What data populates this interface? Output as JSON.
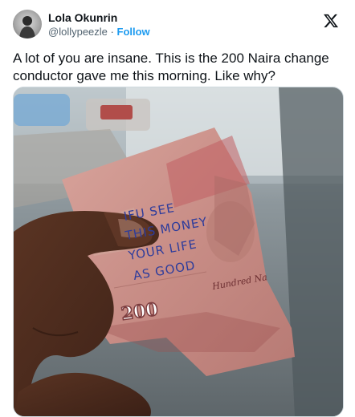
{
  "author": {
    "display_name": "Lola Okunrin",
    "handle": "@lollypeezle",
    "separator": "·",
    "follow_label": "Follow"
  },
  "tweet": {
    "text": "A lot of you are insane. This is the 200 Naira change conductor gave me this morning. Like why?"
  },
  "photo": {
    "handwriting": [
      "IFU SEE",
      "THIS MONEY",
      "YOUR LIFE",
      "AS GOOD"
    ],
    "note_print": [
      "200",
      "Hundred Na"
    ]
  },
  "icons": {
    "platform_logo": "x-logo-icon",
    "avatar": "avatar"
  }
}
